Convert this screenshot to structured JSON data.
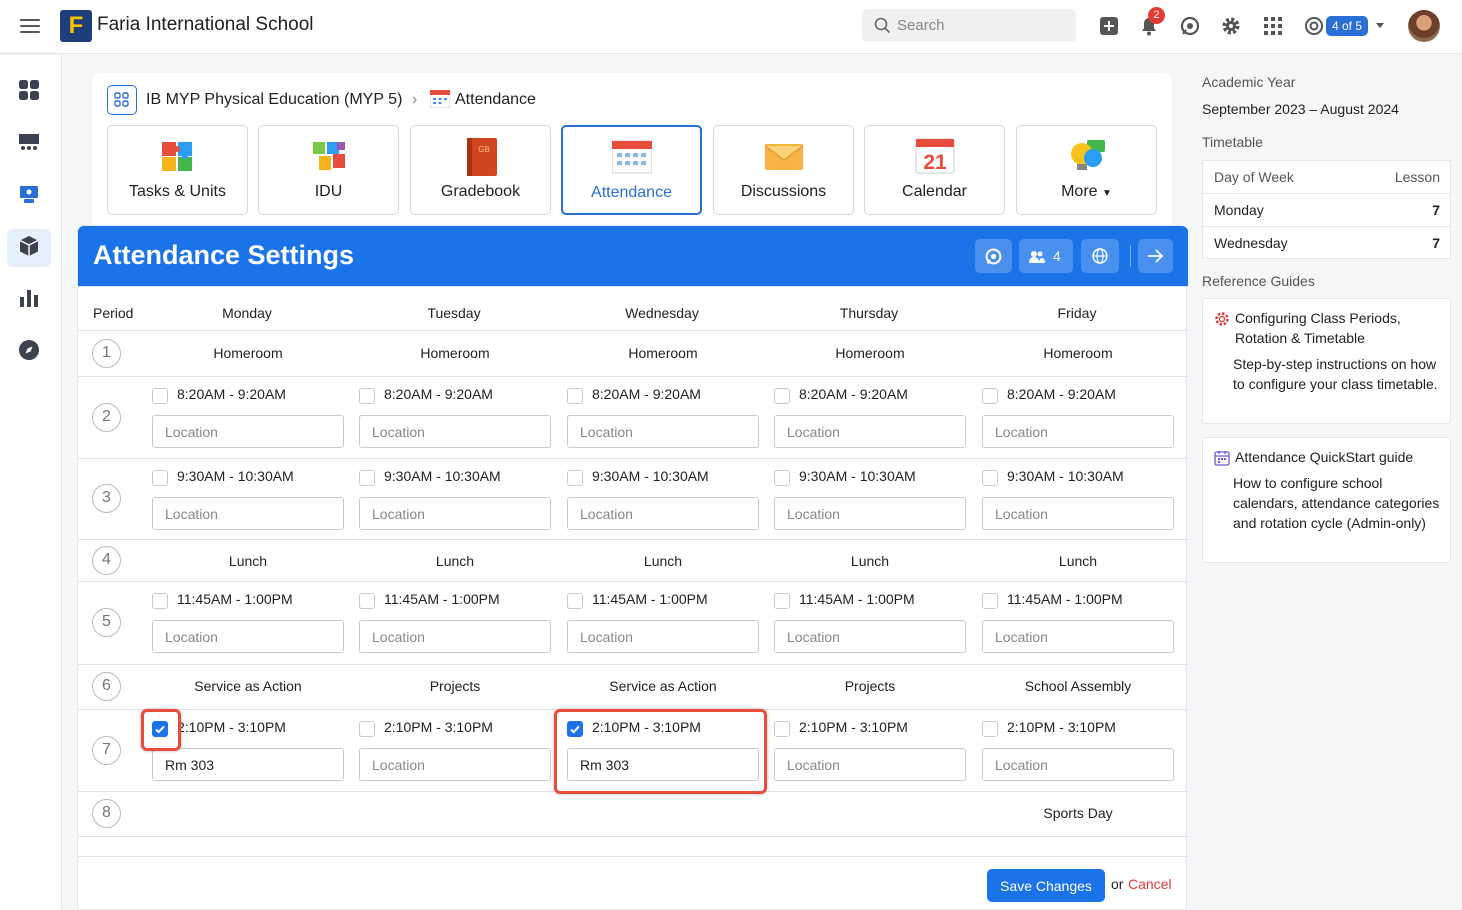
{
  "app": {
    "school_name": "Faria International School",
    "search_placeholder": "Search",
    "notification_count": "2",
    "pager": "4 of 5"
  },
  "breadcrumb": {
    "course": "IB MYP Physical Education (MYP 5)",
    "page": "Attendance"
  },
  "tabs": [
    {
      "label": "Tasks & Units",
      "icon": "puzzle-icon"
    },
    {
      "label": "IDU",
      "icon": "puzzle-pieces-icon"
    },
    {
      "label": "Gradebook",
      "icon": "gradebook-icon"
    },
    {
      "label": "Attendance",
      "icon": "attendance-icon",
      "active": true
    },
    {
      "label": "Discussions",
      "icon": "envelope-icon"
    },
    {
      "label": "Calendar",
      "icon": "calendar-icon",
      "calendar_day": "21"
    },
    {
      "label": "More",
      "icon": "lightbulb-icon"
    }
  ],
  "panel": {
    "title": "Attendance Settings",
    "member_count": "4",
    "save_label": "Save Changes",
    "or_label": "or",
    "cancel_label": "Cancel",
    "location_placeholder": "Location"
  },
  "columns": [
    "Period",
    "Monday",
    "Tuesday",
    "Wednesday",
    "Thursday",
    "Friday"
  ],
  "periods": [
    {
      "num": "1",
      "cells": [
        "Homeroom",
        "Homeroom",
        "Homeroom",
        "Homeroom",
        "Homeroom"
      ]
    },
    {
      "num": "2",
      "time": "8:20AM - 9:20AM",
      "checked": [
        false,
        false,
        false,
        false,
        false
      ],
      "locations": [
        "",
        "",
        "",
        "",
        ""
      ]
    },
    {
      "num": "3",
      "time": "9:30AM - 10:30AM",
      "checked": [
        false,
        false,
        false,
        false,
        false
      ],
      "locations": [
        "",
        "",
        "",
        "",
        ""
      ]
    },
    {
      "num": "4",
      "cells": [
        "Lunch",
        "Lunch",
        "Lunch",
        "Lunch",
        "Lunch"
      ]
    },
    {
      "num": "5",
      "time": "11:45AM - 1:00PM",
      "checked": [
        false,
        false,
        false,
        false,
        false
      ],
      "locations": [
        "",
        "",
        "",
        "",
        ""
      ]
    },
    {
      "num": "6",
      "cells": [
        "Service as Action",
        "Projects",
        "Service as Action",
        "Projects",
        "School Assembly"
      ]
    },
    {
      "num": "7",
      "time": "2:10PM - 3:10PM",
      "checked": [
        true,
        false,
        true,
        false,
        false
      ],
      "locations": [
        "Rm 303",
        "",
        "Rm 303",
        "",
        ""
      ]
    },
    {
      "num": "8",
      "cells": [
        "",
        "",
        "",
        "",
        "Sports Day"
      ]
    }
  ],
  "sidebar_right": {
    "academic_year_label": "Academic Year",
    "academic_year": "September 2023 – August 2024",
    "timetable_label": "Timetable",
    "timetable_headers": [
      "Day of Week",
      "Lesson"
    ],
    "timetable_rows": [
      [
        "Monday",
        "7"
      ],
      [
        "Wednesday",
        "7"
      ]
    ],
    "reference_label": "Reference Guides",
    "guides": [
      {
        "title": "Configuring Class Periods, Rotation & Timetable",
        "desc": "Step-by-step instructions on how to configure your class timetable."
      },
      {
        "title": "Attendance QuickStart guide",
        "desc": "How to configure school calendars, attendance categories and rotation cycle (Admin-only)"
      }
    ]
  },
  "colors": {
    "primary": "#1a73e8",
    "highlight": "#e74c3c",
    "cancel": "#e53935"
  }
}
